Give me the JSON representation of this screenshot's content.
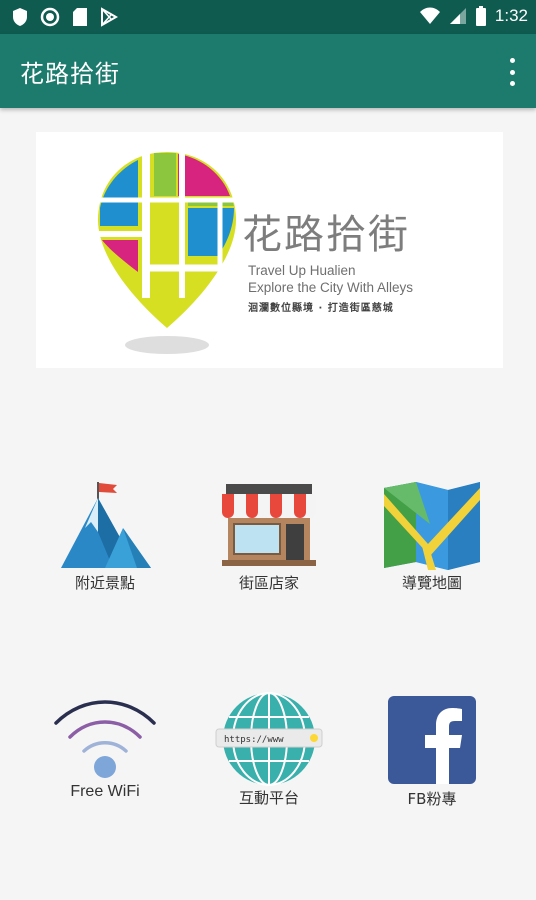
{
  "status_bar": {
    "time": "1:32"
  },
  "app_bar": {
    "title": "花路拾街"
  },
  "banner": {
    "title": "花路拾街",
    "line1": "Travel Up Hualien",
    "line2": "Explore the City With Alleys",
    "line3": "洄瀾數位縣境 · 打造街區慈城"
  },
  "menu": [
    {
      "label": "附近景點",
      "icon": "mountain-icon"
    },
    {
      "label": "街區店家",
      "icon": "storefront-icon"
    },
    {
      "label": "導覽地圖",
      "icon": "map-icon"
    },
    {
      "label": "Free WiFi",
      "icon": "wifi-icon"
    },
    {
      "label": "互動平台",
      "icon": "globe-icon",
      "url_text": "https://www"
    },
    {
      "label": "FB粉專",
      "icon": "facebook-icon"
    }
  ],
  "colors": {
    "status_bar": "#0f5b50",
    "app_bar": "#1c7b6d",
    "logo_magenta": "#d6247f",
    "logo_blue": "#1f8fd0",
    "logo_green": "#8cc63f",
    "logo_yellow": "#d7df23",
    "facebook": "#3b5998"
  }
}
